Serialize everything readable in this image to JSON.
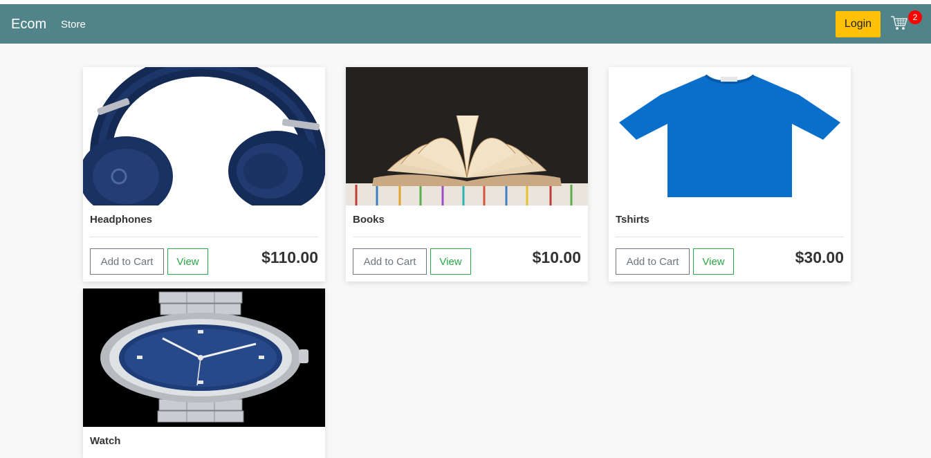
{
  "navbar": {
    "brand": "Ecom",
    "links": [
      "Store"
    ],
    "login_label": "Login",
    "cart_count": "2",
    "cart_icon": "shopping-cart-icon",
    "colors": {
      "navbar": "#518489",
      "login": "#ffc107",
      "badge": "#ff0000"
    }
  },
  "products": [
    {
      "name": "Headphones",
      "price": "$110.00",
      "add_label": "Add to Cart",
      "view_label": "View",
      "image": "headphones"
    },
    {
      "name": "Books",
      "price": "$10.00",
      "add_label": "Add to Cart",
      "view_label": "View",
      "image": "books"
    },
    {
      "name": "Tshirts",
      "price": "$30.00",
      "add_label": "Add to Cart",
      "view_label": "View",
      "image": "tshirt"
    },
    {
      "name": "Watch",
      "price": "",
      "add_label": "",
      "view_label": "",
      "image": "watch"
    }
  ]
}
